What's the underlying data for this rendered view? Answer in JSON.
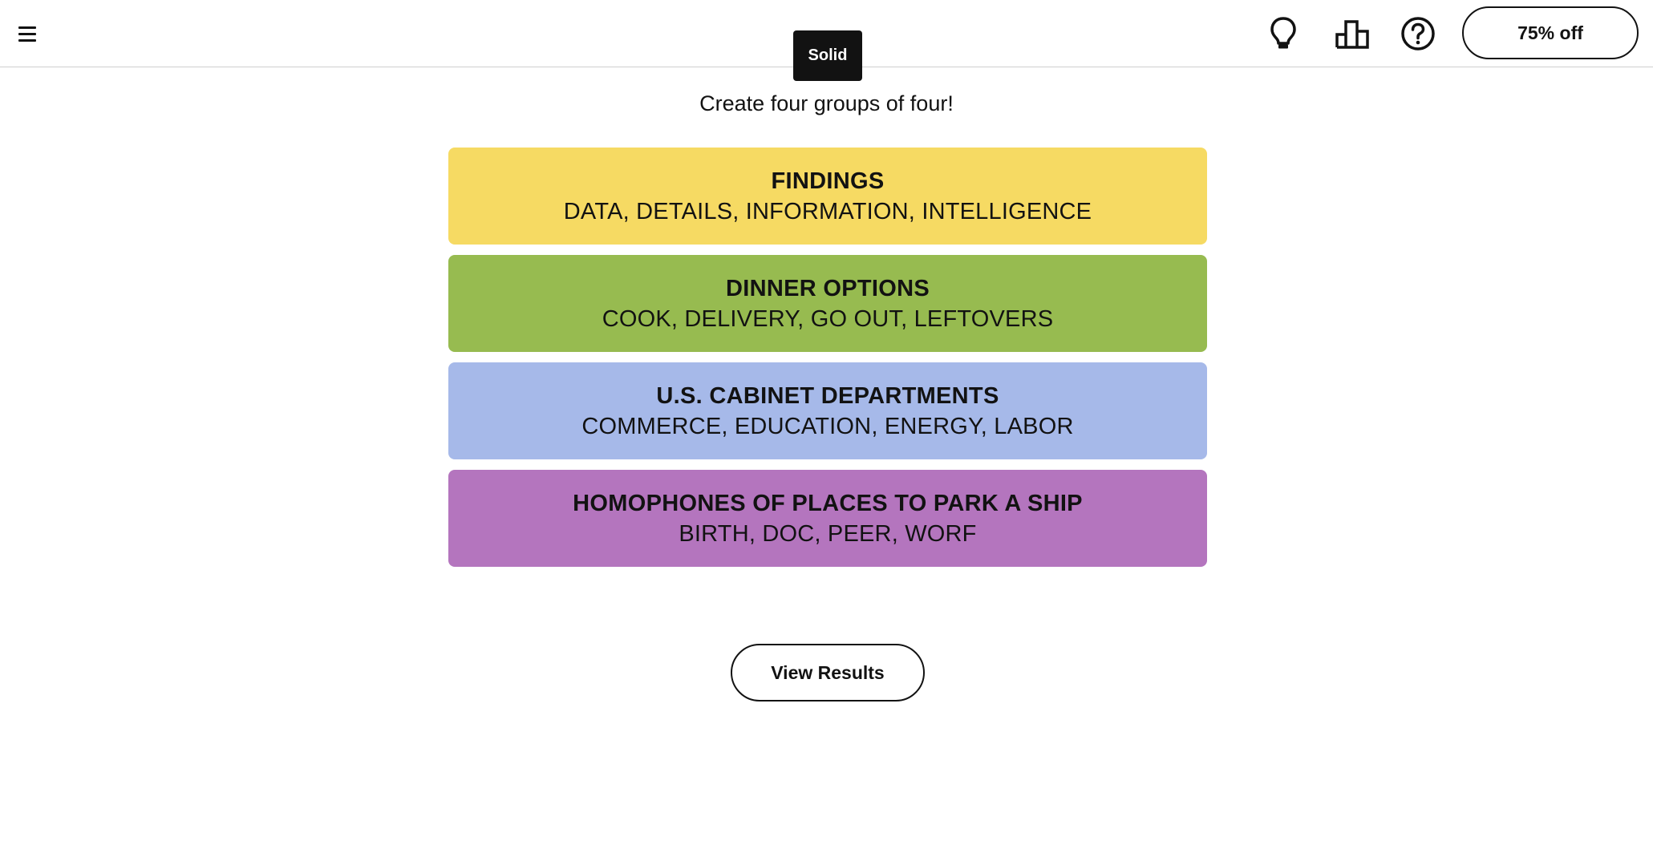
{
  "header": {
    "menu_icon": "hamburger-menu-icon",
    "hint_icon": "lightbulb-icon",
    "stats_icon": "bar-chart-icon",
    "help_icon": "question-mark-icon",
    "promo_label": "75% off"
  },
  "toast": {
    "label": "Solid"
  },
  "instructions": "Create four groups of four!",
  "groups": [
    {
      "title": "FINDINGS",
      "members": "DATA, DETAILS, INFORMATION, INTELLIGENCE",
      "color": "#f6da63"
    },
    {
      "title": "DINNER OPTIONS",
      "members": "COOK, DELIVERY, GO OUT, LEFTOVERS",
      "color": "#97bb50"
    },
    {
      "title": "U.S. CABINET DEPARTMENTS",
      "members": "COMMERCE, EDUCATION, ENERGY, LABOR",
      "color": "#a6b9e9"
    },
    {
      "title": "HOMOPHONES OF PLACES TO PARK A SHIP",
      "members": "BIRTH, DOC, PEER, WORF",
      "color": "#b475be"
    }
  ],
  "view_results_label": "View Results"
}
